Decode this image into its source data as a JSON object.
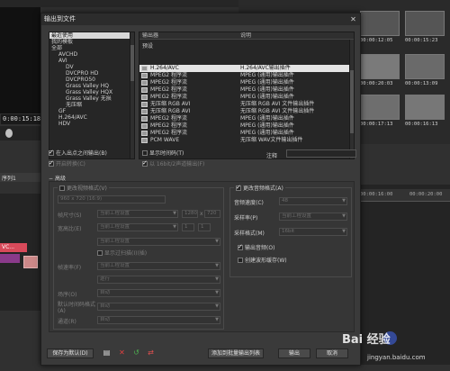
{
  "dialog": {
    "title": "输出到文件",
    "categories": [
      {
        "label": "最近使用",
        "selected": true
      },
      {
        "label": "我的模板"
      },
      {
        "label": "全部"
      },
      {
        "label": "AVCHD"
      },
      {
        "label": "AVI"
      },
      {
        "label": "DV"
      },
      {
        "label": "DVCPRO HD"
      },
      {
        "label": "DVCPRO50"
      },
      {
        "label": "Grass Valley HQ"
      },
      {
        "label": "Grass Valley HQX"
      },
      {
        "label": "Grass Valley 无损"
      },
      {
        "label": "无压缩"
      },
      {
        "label": "GF"
      },
      {
        "label": "H.264/AVC"
      },
      {
        "label": "HDV"
      }
    ],
    "template_list": {
      "col_exporter": "输出器",
      "col_desc": "说明",
      "preset_label": "预设",
      "rows": [
        {
          "name": "H.264/AVC",
          "desc": "H.264/AVC输出插件",
          "selected": true
        },
        {
          "name": "MPEG2 程序流",
          "desc": "MPEG (通用)输出插件"
        },
        {
          "name": "MPEG2 程序流",
          "desc": "MPEG (通用)输出插件"
        },
        {
          "name": "MPEG2 程序流",
          "desc": "MPEG (通用)输出插件"
        },
        {
          "name": "MPEG2 程序流",
          "desc": "MPEG (通用)输出插件"
        },
        {
          "name": "无压缩 RGB AVI",
          "desc": "无压缩 RGB AVI 文件输出插件"
        },
        {
          "name": "无压缩 RGB AVI",
          "desc": "无压缩 RGB AVI 文件输出插件"
        },
        {
          "name": "MPEG2 程序流",
          "desc": "MPEG (通用)输出插件"
        },
        {
          "name": "MPEG2 程序流",
          "desc": "MPEG (通用)输出插件"
        },
        {
          "name": "MPEG2 程序流",
          "desc": "MPEG (通用)输出插件"
        },
        {
          "name": "PCM WAVE",
          "desc": "无压缩 WAV文件输出插件"
        }
      ]
    },
    "options": {
      "in_out_only": "在入出点之间输出(B)",
      "show_all": "显示时间码(T)",
      "enable_batch": "开启转换(C)",
      "export_16bit": "以 16bit/2声道输出(F)",
      "notes_label": "注释"
    },
    "advanced": {
      "title": "高级",
      "video": {
        "group_title": "更改视频格式(V)",
        "format_value": "960 x 720 (16:9)",
        "frame_size_label": "帧尺寸(S)",
        "frame_size_value": "当前工程设置",
        "width": "1280",
        "height": "720",
        "aspect_label": "宽高比(E)",
        "aspect_value": "当前工程设置",
        "aspect_x": "1",
        "aspect_y": "1",
        "row3_value": "当前工程设置",
        "interlace_check": "显示过扫描(I)(插)",
        "frame_rate_label": "帧速率(F)",
        "frame_rate_value": "当前工程设置",
        "row5_value": "逐行",
        "field_order_label": "场序(O)",
        "field_order_value": "自动",
        "default_time_label": "默认时间码格式(A)",
        "default_time_value": "自动",
        "channel_label": "通道(R)",
        "channel_value": "自动"
      },
      "audio": {
        "group_title": "更改音频格式(A)",
        "sample_rate_label": "音频速度(C)",
        "sample_rate_value": "48",
        "sample_format_label": "采样率(P)",
        "sample_format_value": "当前工程设置",
        "bit_label": "采样格式(M)",
        "bit_value": "16bit",
        "check1": "输出音频(O)",
        "check2": "创建波形缓存(W)"
      }
    },
    "buttons": {
      "save_default": "保存为默认(D)",
      "add_batch": "添加到批量输出列表",
      "output": "输出",
      "cancel": "取消"
    }
  },
  "background": {
    "timecode": "0:00:15:18",
    "seq_tab": "序列1",
    "clip_label": "VC...",
    "thumb_labels": [
      "00:00:12:05",
      "00:00:15:23",
      "00:00:20:03",
      "00:00:13:09",
      "00:00:17:13",
      "00:00:16:13"
    ],
    "ruler_labels": [
      "00:00:16:00",
      "00:00:20:00"
    ]
  },
  "watermark": {
    "logo": "Bai 经验",
    "url": "jingyan.baidu.com"
  }
}
